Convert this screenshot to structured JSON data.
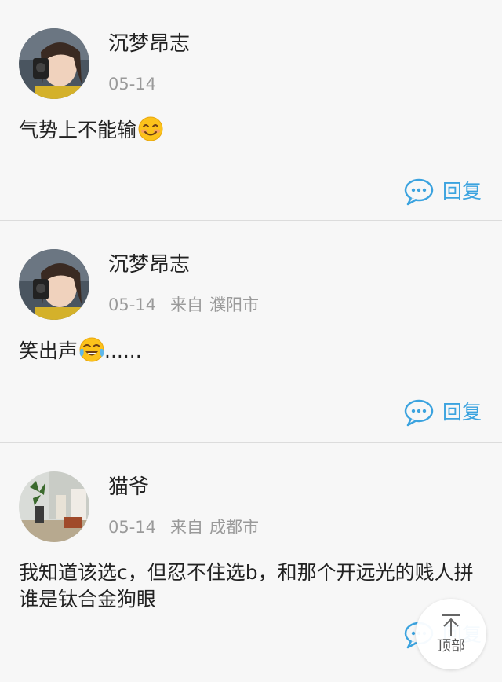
{
  "comments": [
    {
      "username": "沉梦昂志",
      "date": "05-14",
      "from_label": "",
      "city": "",
      "text": "气势上不能输",
      "emoji": "smiling-face-emoji",
      "reply_label": "回复"
    },
    {
      "username": "沉梦昂志",
      "date": "05-14",
      "from_label": "来自",
      "city": "濮阳市",
      "text": "笑出声",
      "text_suffix": "......",
      "emoji": "tears-of-joy-emoji",
      "reply_label": "回复"
    },
    {
      "username": "猫爷",
      "date": "05-14",
      "from_label": "来自",
      "city": "成都市",
      "text": "我知道该选c，但忍不住选b，和那个开远光的贱人拼谁是钛合金狗眼",
      "reply_label": "回复"
    }
  ],
  "back_to_top": {
    "label": "顶部",
    "icon": "arrow-up-icon"
  },
  "colors": {
    "accent": "#3ba3df",
    "meta_text": "#9a9a9a",
    "background": "#f7f7f7",
    "divider": "#dcdcdc"
  }
}
